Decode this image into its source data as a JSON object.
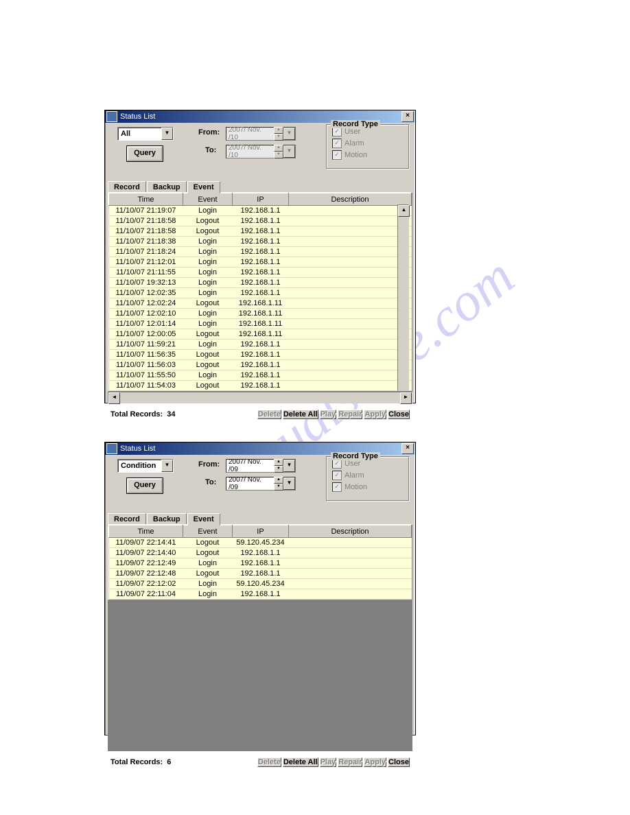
{
  "watermark": "manualshive.com",
  "dialogs": [
    {
      "title": "Status List",
      "filter": "All",
      "query": "Query",
      "from_label": "From:",
      "to_label": "To:",
      "from_value": "2007/ Nov. /10",
      "to_value": "2007/ Nov. /10",
      "record_type": {
        "legend": "Record Type",
        "items": [
          "User",
          "Alarm",
          "Motion"
        ]
      },
      "tabs": [
        "Record",
        "Backup",
        "Event"
      ],
      "active_tab": 2,
      "columns": [
        "Time",
        "Event",
        "IP",
        "Description"
      ],
      "rows": [
        {
          "time": "11/10/07 21:19:07",
          "event": "Login",
          "ip": "192.168.1.1",
          "desc": ""
        },
        {
          "time": "11/10/07 21:18:58",
          "event": "Logout",
          "ip": "192.168.1.1",
          "desc": ""
        },
        {
          "time": "11/10/07 21:18:58",
          "event": "Logout",
          "ip": "192.168.1.1",
          "desc": ""
        },
        {
          "time": "11/10/07 21:18:38",
          "event": "Login",
          "ip": "192.168.1.1",
          "desc": ""
        },
        {
          "time": "11/10/07 21:18:24",
          "event": "Login",
          "ip": "192.168.1.1",
          "desc": ""
        },
        {
          "time": "11/10/07 21:12:01",
          "event": "Login",
          "ip": "192.168.1.1",
          "desc": ""
        },
        {
          "time": "11/10/07 21:11:55",
          "event": "Login",
          "ip": "192.168.1.1",
          "desc": ""
        },
        {
          "time": "11/10/07 19:32:13",
          "event": "Login",
          "ip": "192.168.1.1",
          "desc": ""
        },
        {
          "time": "11/10/07 12:02:35",
          "event": "Login",
          "ip": "192.168.1.1",
          "desc": ""
        },
        {
          "time": "11/10/07 12:02:24",
          "event": "Logout",
          "ip": "192.168.1.11",
          "desc": ""
        },
        {
          "time": "11/10/07 12:02:10",
          "event": "Login",
          "ip": "192.168.1.11",
          "desc": ""
        },
        {
          "time": "11/10/07 12:01:14",
          "event": "Login",
          "ip": "192.168.1.11",
          "desc": ""
        },
        {
          "time": "11/10/07 12:00:05",
          "event": "Logout",
          "ip": "192.168.1.11",
          "desc": ""
        },
        {
          "time": "11/10/07 11:59:21",
          "event": "Login",
          "ip": "192.168.1.1",
          "desc": ""
        },
        {
          "time": "11/10/07 11:56:35",
          "event": "Logout",
          "ip": "192.168.1.1",
          "desc": ""
        },
        {
          "time": "11/10/07 11:56:03",
          "event": "Logout",
          "ip": "192.168.1.1",
          "desc": ""
        },
        {
          "time": "11/10/07 11:55:50",
          "event": "Login",
          "ip": "192.168.1.1",
          "desc": ""
        },
        {
          "time": "11/10/07 11:54:03",
          "event": "Logout",
          "ip": "192.168.1.1",
          "desc": ""
        }
      ],
      "total_label": "Total Records:",
      "total": "34",
      "buttons": [
        {
          "label": "Delete",
          "enabled": false
        },
        {
          "label": "Delete All",
          "enabled": true
        },
        {
          "label": "Play",
          "enabled": false
        },
        {
          "label": "Repair",
          "enabled": false
        },
        {
          "label": "Apply",
          "enabled": false
        },
        {
          "label": "Close",
          "enabled": true
        }
      ]
    },
    {
      "title": "Status List",
      "filter": "Condition",
      "query": "Query",
      "from_label": "From:",
      "to_label": "To:",
      "from_value": "2007/ Nov. /09",
      "to_value": "2007/ Nov. /09",
      "record_type": {
        "legend": "Record Type",
        "items": [
          "User",
          "Alarm",
          "Motion"
        ]
      },
      "tabs": [
        "Record",
        "Backup",
        "Event"
      ],
      "active_tab": 2,
      "columns": [
        "Time",
        "Event",
        "IP",
        "Description"
      ],
      "rows": [
        {
          "time": "11/09/07 22:14:41",
          "event": "Logout",
          "ip": "59.120.45.234",
          "desc": ""
        },
        {
          "time": "11/09/07 22:14:40",
          "event": "Logout",
          "ip": "192.168.1.1",
          "desc": ""
        },
        {
          "time": "11/09/07 22:12:49",
          "event": "Login",
          "ip": "192.168.1.1",
          "desc": ""
        },
        {
          "time": "11/09/07 22:12:48",
          "event": "Logout",
          "ip": "192.168.1.1",
          "desc": ""
        },
        {
          "time": "11/09/07 22:12:02",
          "event": "Login",
          "ip": "59.120.45.234",
          "desc": ""
        },
        {
          "time": "11/09/07 22:11:04",
          "event": "Login",
          "ip": "192.168.1.1",
          "desc": ""
        }
      ],
      "total_label": "Total Records:",
      "total": "6",
      "buttons": [
        {
          "label": "Delete",
          "enabled": false
        },
        {
          "label": "Delete All",
          "enabled": true
        },
        {
          "label": "Play",
          "enabled": false
        },
        {
          "label": "Repair",
          "enabled": false
        },
        {
          "label": "Apply",
          "enabled": false
        },
        {
          "label": "Close",
          "enabled": true
        }
      ]
    }
  ]
}
